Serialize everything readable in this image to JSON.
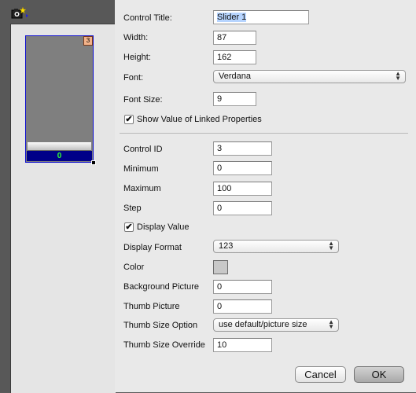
{
  "canvas": {
    "slider_badge": "3",
    "slider_value": "0"
  },
  "form": {
    "control_title_label": "Control Title:",
    "control_title_value": "Slider 1",
    "width_label": "Width:",
    "width_value": "87",
    "height_label": "Height:",
    "height_value": "162",
    "font_label": "Font:",
    "font_value": "Verdana",
    "font_size_label": "Font Size:",
    "font_size_value": "9",
    "show_value_linked_label": "Show Value of Linked Properties",
    "show_value_linked_checked": true,
    "control_id_label": "Control ID",
    "control_id_value": "3",
    "minimum_label": "Minimum",
    "minimum_value": "0",
    "maximum_label": "Maximum",
    "maximum_value": "100",
    "step_label": "Step",
    "step_value": "0",
    "display_value_label": "Display Value",
    "display_value_checked": true,
    "display_format_label": "Display Format",
    "display_format_value": "123",
    "color_label": "Color",
    "color_value": "#c8c8c8",
    "background_picture_label": "Background Picture",
    "background_picture_value": "0",
    "thumb_picture_label": "Thumb Picture",
    "thumb_picture_value": "0",
    "thumb_size_option_label": "Thumb Size Option",
    "thumb_size_option_value": "use default/picture size",
    "thumb_size_override_label": "Thumb Size Override",
    "thumb_size_override_value": "10"
  },
  "buttons": {
    "cancel": "Cancel",
    "ok": "OK"
  }
}
